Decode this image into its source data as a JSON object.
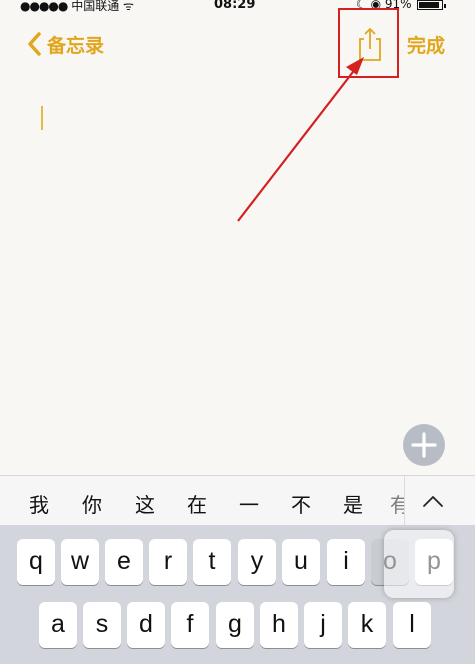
{
  "status_bar": {
    "signal_dots": "●●●●●",
    "carrier": "中国联通",
    "wifi_glyph": "ᯤ",
    "time": "08:29",
    "moon_glyph": "☾",
    "lock_glyph": "◉",
    "battery_text": "91%",
    "battery_level": 0.91
  },
  "nav": {
    "back_label": "备忘录",
    "done_label": "完成",
    "share_icon": "share-icon"
  },
  "candidates": [
    "我",
    "你",
    "这",
    "在",
    "一",
    "不",
    "是",
    "有"
  ],
  "candidate_expand_icon": "chevron-up-icon",
  "keyboard": {
    "row1": [
      "q",
      "w",
      "e",
      "r",
      "t",
      "y",
      "u",
      "i",
      "o",
      "p"
    ],
    "row2": [
      "a",
      "s",
      "d",
      "f",
      "g",
      "h",
      "j",
      "k",
      "l"
    ],
    "pressed_key": "o"
  },
  "colors": {
    "accent": "#e1a61c",
    "annotation_red": "#d32020",
    "paper": "#f8f7f4",
    "keyboard_bg": "#d2d5db"
  }
}
